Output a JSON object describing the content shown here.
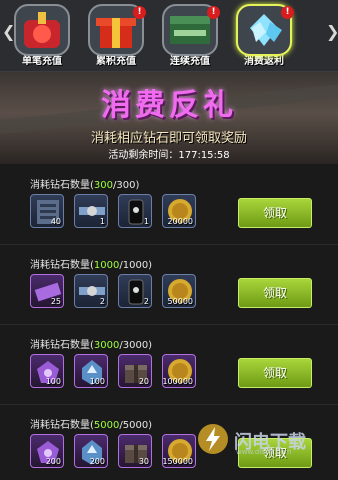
{
  "tabs": [
    {
      "label": "单笔充值",
      "active": false,
      "badge": ""
    },
    {
      "label": "累积充值",
      "active": false,
      "badge": "!"
    },
    {
      "label": "连续充值",
      "active": false,
      "badge": "!"
    },
    {
      "label": "消费返利",
      "active": true,
      "badge": "!"
    }
  ],
  "banner": {
    "title": "消费反礼",
    "subtitle": "消耗相应钻石即可领取奖励",
    "timer_label": "活动剩余时间：",
    "timer_value": "177:15:58"
  },
  "rows": [
    {
      "label": "消耗钻石数量",
      "current": "300",
      "total": "/300)",
      "button": "领取",
      "items": [
        {
          "icon": "server-icon",
          "qty": "40"
        },
        {
          "icon": "satellite-icon",
          "qty": "1"
        },
        {
          "icon": "oil-barrel-icon",
          "qty": "1"
        },
        {
          "icon": "gold-coin-icon",
          "qty": "20000"
        }
      ]
    },
    {
      "label": "消耗钻石数量",
      "current": "1000",
      "total": "/1000)",
      "button": "领取",
      "items": [
        {
          "icon": "purple-ticket-icon",
          "qty": "25"
        },
        {
          "icon": "satellite-icon",
          "qty": "2"
        },
        {
          "icon": "oil-barrel-icon",
          "qty": "2"
        },
        {
          "icon": "gold-coin-icon",
          "qty": "50000"
        }
      ]
    },
    {
      "label": "消耗钻石数量",
      "current": "3000",
      "total": "/3000)",
      "button": "领取",
      "items": [
        {
          "icon": "purple-chip-icon",
          "qty": "100"
        },
        {
          "icon": "upgrade-crystal-icon",
          "qty": "100"
        },
        {
          "icon": "supply-crate-icon",
          "qty": "20"
        },
        {
          "icon": "gold-coin-icon",
          "qty": "100000"
        }
      ]
    },
    {
      "label": "消耗钻石数量",
      "current": "5000",
      "total": "/5000)",
      "button": "领取",
      "items": [
        {
          "icon": "purple-chip-icon",
          "qty": "200"
        },
        {
          "icon": "upgrade-crystal-icon",
          "qty": "200"
        },
        {
          "icon": "supply-crate-icon",
          "qty": "30"
        },
        {
          "icon": "gold-coin-icon",
          "qty": "150000"
        }
      ]
    }
  ],
  "watermark": {
    "text": "闪电下载",
    "url": "www.dlsoft.com"
  }
}
